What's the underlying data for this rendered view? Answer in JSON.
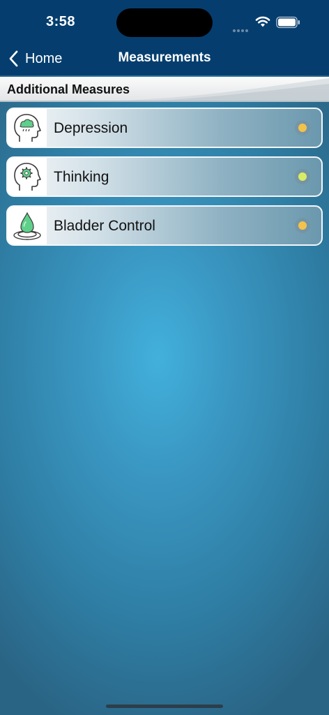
{
  "status_bar": {
    "time": "3:58"
  },
  "nav": {
    "back_label": "Home",
    "title": "Measurements"
  },
  "section": {
    "title": "Additional Measures"
  },
  "items": [
    {
      "label": "Depression",
      "icon": "head-raincloud-icon",
      "status_color": "#f3c24b"
    },
    {
      "label": "Thinking",
      "icon": "head-gear-icon",
      "status_color": "#d8ec66"
    },
    {
      "label": "Bladder Control",
      "icon": "water-drop-icon",
      "status_color": "#f3c24b"
    }
  ],
  "colors": {
    "header": "#053e6e",
    "icon_green": "#5fd08a"
  }
}
